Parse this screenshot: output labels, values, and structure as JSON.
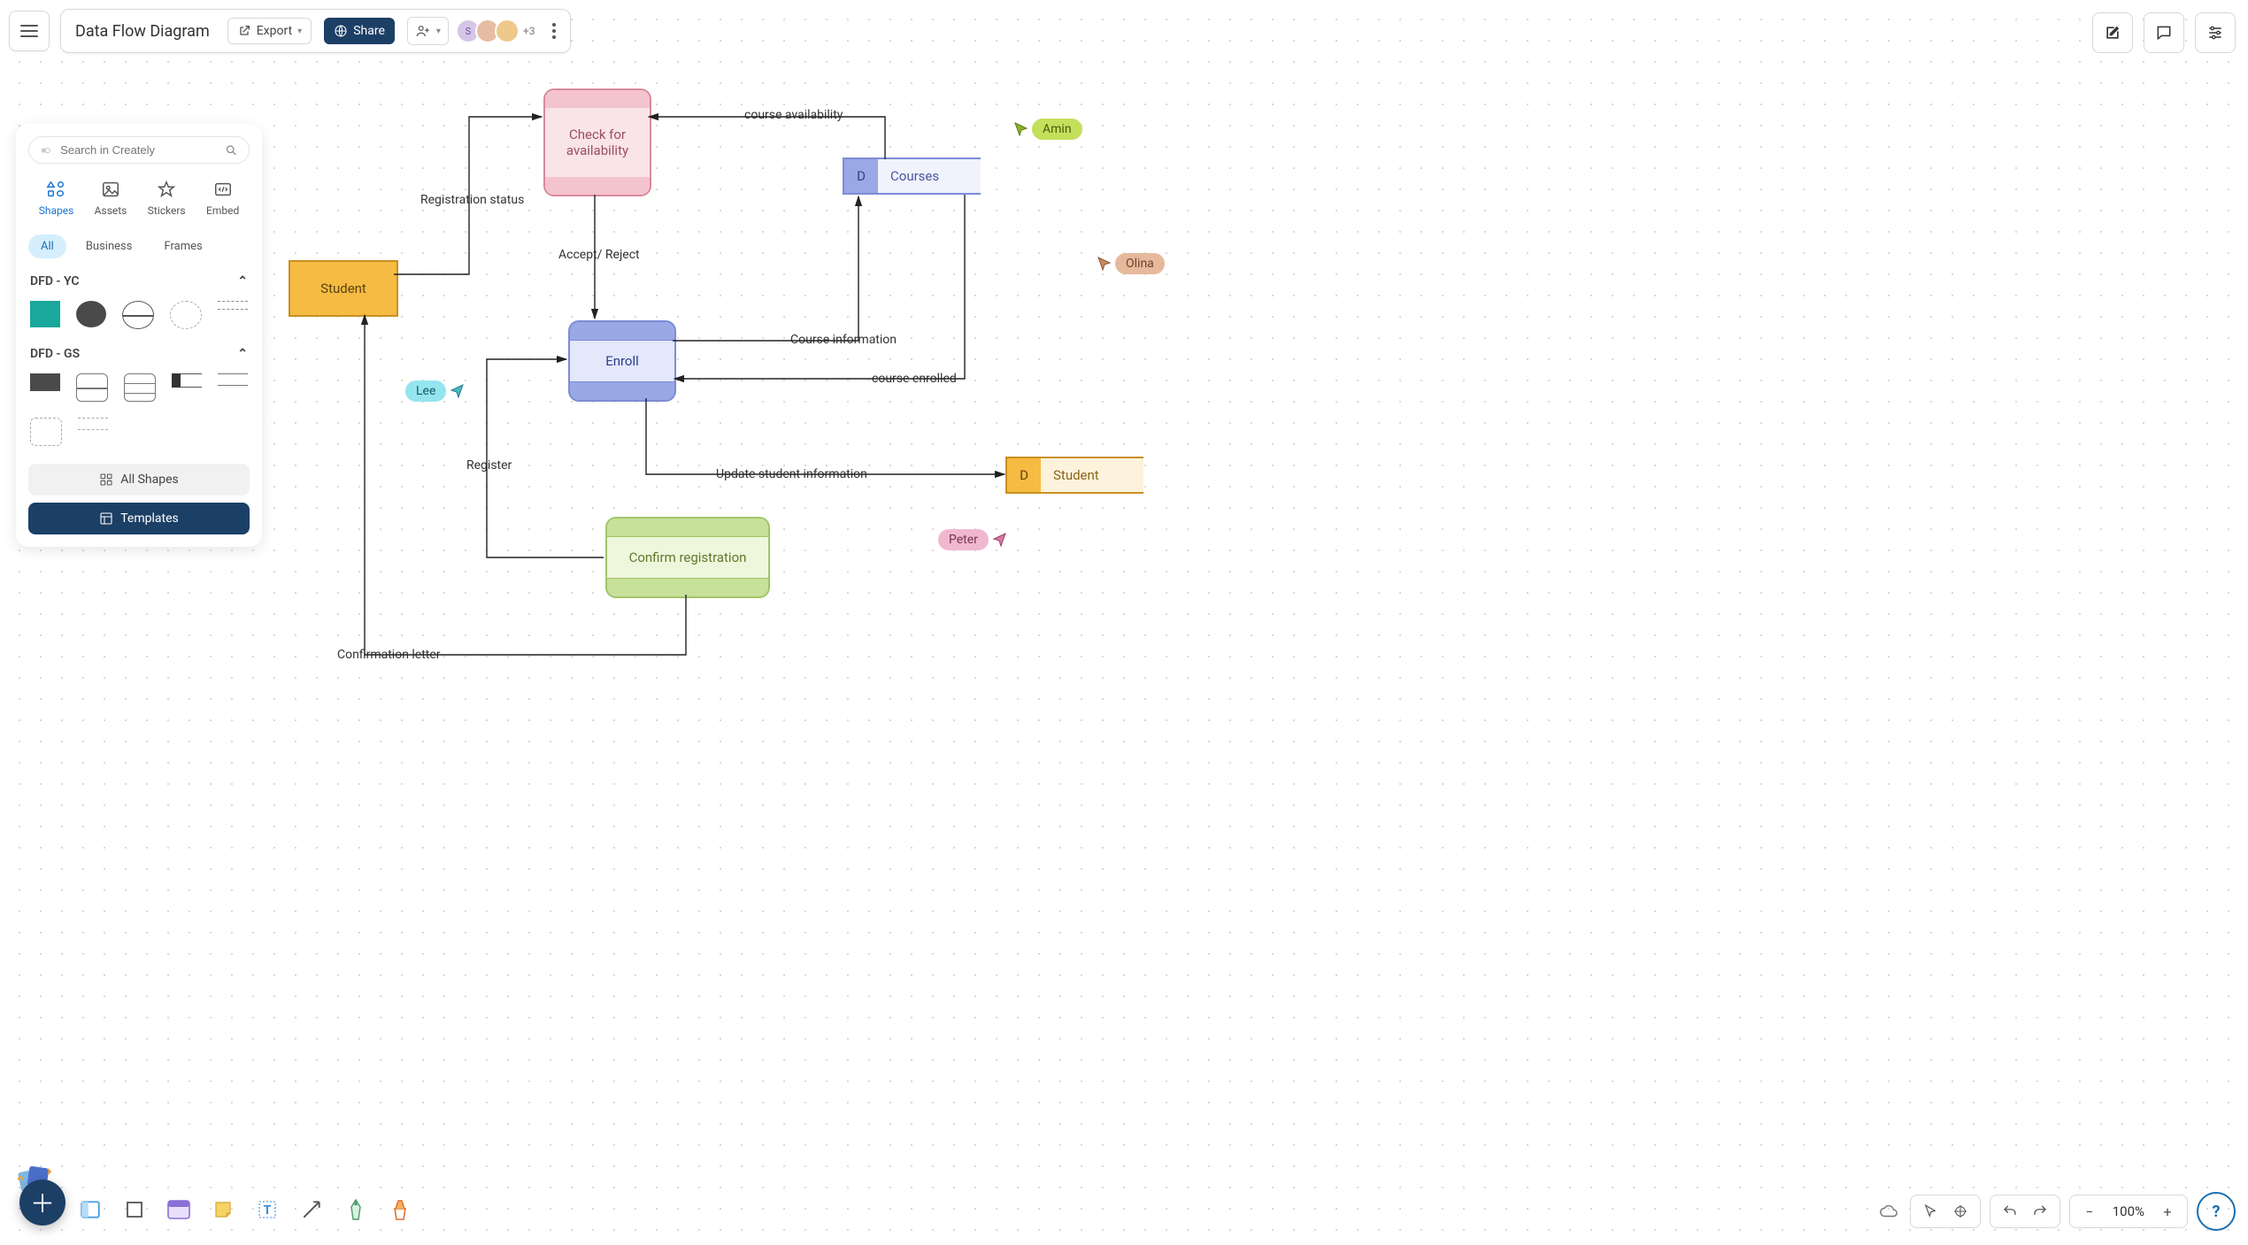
{
  "document": {
    "title": "Data Flow Diagram"
  },
  "toolbar": {
    "export_label": "Export",
    "share_label": "Share",
    "avatars": {
      "initial": "S",
      "more": "+3"
    }
  },
  "sidepanel": {
    "search_placeholder": "Search in Creately",
    "tabs": {
      "shapes": "Shapes",
      "assets": "Assets",
      "stickers": "Stickers",
      "embed": "Embed"
    },
    "chips": {
      "all": "All",
      "business": "Business",
      "frames": "Frames"
    },
    "sections": {
      "yc": "DFD - YC",
      "gs": "DFD - GS"
    },
    "all_shapes": "All Shapes",
    "templates": "Templates"
  },
  "bottomright": {
    "zoom": "100%"
  },
  "help": {
    "label": "?"
  },
  "diagram": {
    "nodes": {
      "check": "Check for availability",
      "enroll": "Enroll",
      "confirm": "Confirm registration",
      "student_entity": "Student",
      "courses_d": "D",
      "courses_label": "Courses",
      "student_ds_d": "D",
      "student_ds_label": "Student"
    },
    "edges": {
      "reg_status": "Registration status",
      "accept_reject": "Accept/ Reject",
      "course_avail": "course availability",
      "course_info": "Course information",
      "course_enrolled": "course enrolled",
      "register": "Register",
      "update_student": "Update student information",
      "confirmation": "Confirmation letter"
    },
    "cursors": {
      "amin": "Amin",
      "olina": "Olina",
      "lee": "Lee",
      "peter": "Peter"
    }
  }
}
